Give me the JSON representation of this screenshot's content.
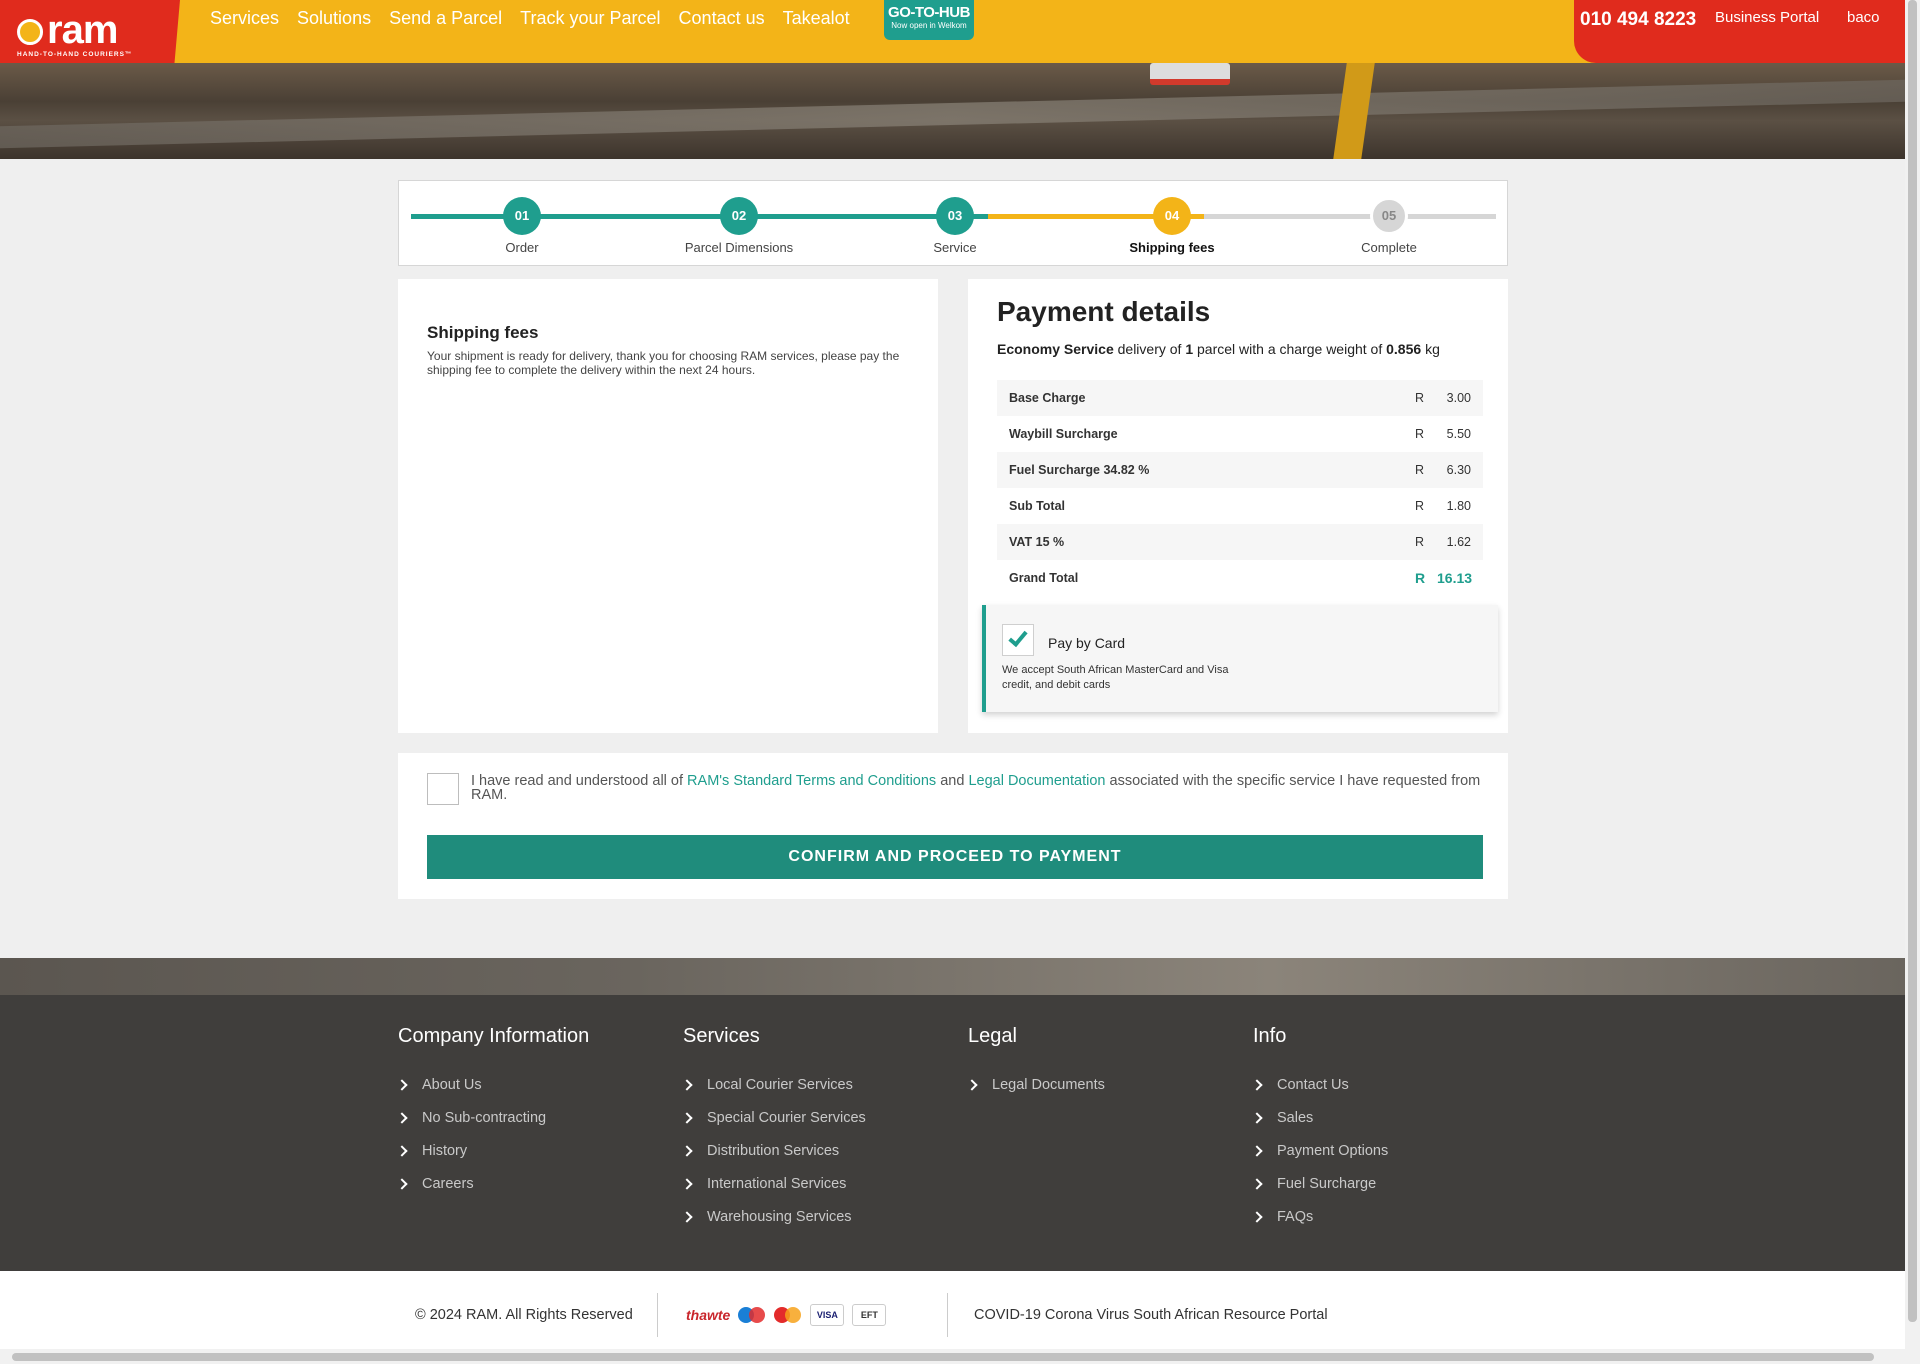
{
  "header": {
    "brand": "RAM",
    "brand_tagline": "HAND-TO-HAND COURIERS™",
    "nav": [
      "Services",
      "Solutions",
      "Send a Parcel",
      "Track your Parcel",
      "Contact us",
      "Takealot"
    ],
    "gotohub": {
      "title": "GO-TO-HUB",
      "subtitle": "Now open in Welkom"
    },
    "phone": "010 494 8223",
    "business_portal": "Business Portal",
    "user": "baco",
    "colors": {
      "brand_yellow": "#f3b418",
      "brand_red": "#e02b1d",
      "accent_teal": "#1f9e8e"
    }
  },
  "stepper": {
    "steps": [
      {
        "num": "01",
        "label": "Order",
        "state": "done"
      },
      {
        "num": "02",
        "label": "Parcel Dimensions",
        "state": "done"
      },
      {
        "num": "03",
        "label": "Service",
        "state": "done"
      },
      {
        "num": "04",
        "label": "Shipping fees",
        "state": "active"
      },
      {
        "num": "05",
        "label": "Complete",
        "state": "pending"
      }
    ]
  },
  "shipping": {
    "title": "Shipping fees",
    "message": "Your shipment is ready for delivery, thank you for choosing RAM services, please pay the shipping fee to complete the delivery within the next 24 hours."
  },
  "payment": {
    "title": "Payment details",
    "service": "Economy Service",
    "delivery_of": "delivery of",
    "parcel_count": "1",
    "parcel_text": "parcel with a charge weight of",
    "weight": "0.856",
    "weight_unit": "kg",
    "currency": "R",
    "charges": [
      {
        "name": "Base Charge",
        "amount": "3.00"
      },
      {
        "name": "Waybill Surcharge",
        "amount": "5.50"
      },
      {
        "name": "Fuel Surcharge 34.82 %",
        "amount": "6.30"
      },
      {
        "name": "Sub Total",
        "amount": "1.80"
      },
      {
        "name": "VAT 15 %",
        "amount": "1.62"
      },
      {
        "name": "Grand Total",
        "amount": "16.13"
      }
    ],
    "pay_by_card": {
      "label": "Pay by Card",
      "checked": true,
      "description": "We accept South African MasterCard and Visa credit, and debit cards"
    }
  },
  "terms": {
    "prefix": "I have read and understood all of",
    "link1": "RAM's Standard Terms and Conditions",
    "and": "and",
    "link2": "Legal Documentation",
    "suffix": "associated with the specific service I have requested from RAM.",
    "checked": false,
    "confirm_label": "CONFIRM AND PROCEED TO PAYMENT"
  },
  "footer": {
    "columns": [
      {
        "title": "Company Information",
        "items": [
          "About Us",
          "No Sub-contracting",
          "History",
          "Careers"
        ]
      },
      {
        "title": "Services",
        "items": [
          "Local Courier Services",
          "Special Courier Services",
          "Distribution Services",
          "International Services",
          "Warehousing Services"
        ]
      },
      {
        "title": "Legal",
        "items": [
          "Legal Documents"
        ]
      },
      {
        "title": "Info",
        "items": [
          "Contact Us",
          "Sales",
          "Payment Options",
          "Fuel Surcharge",
          "FAQs"
        ]
      }
    ],
    "copyright": "© 2024 RAM. All Rights Reserved",
    "payment_logos": [
      "thawte",
      "VISA",
      "EFT"
    ],
    "covid_link": "COVID-19 Corona Virus South African Resource Portal"
  }
}
